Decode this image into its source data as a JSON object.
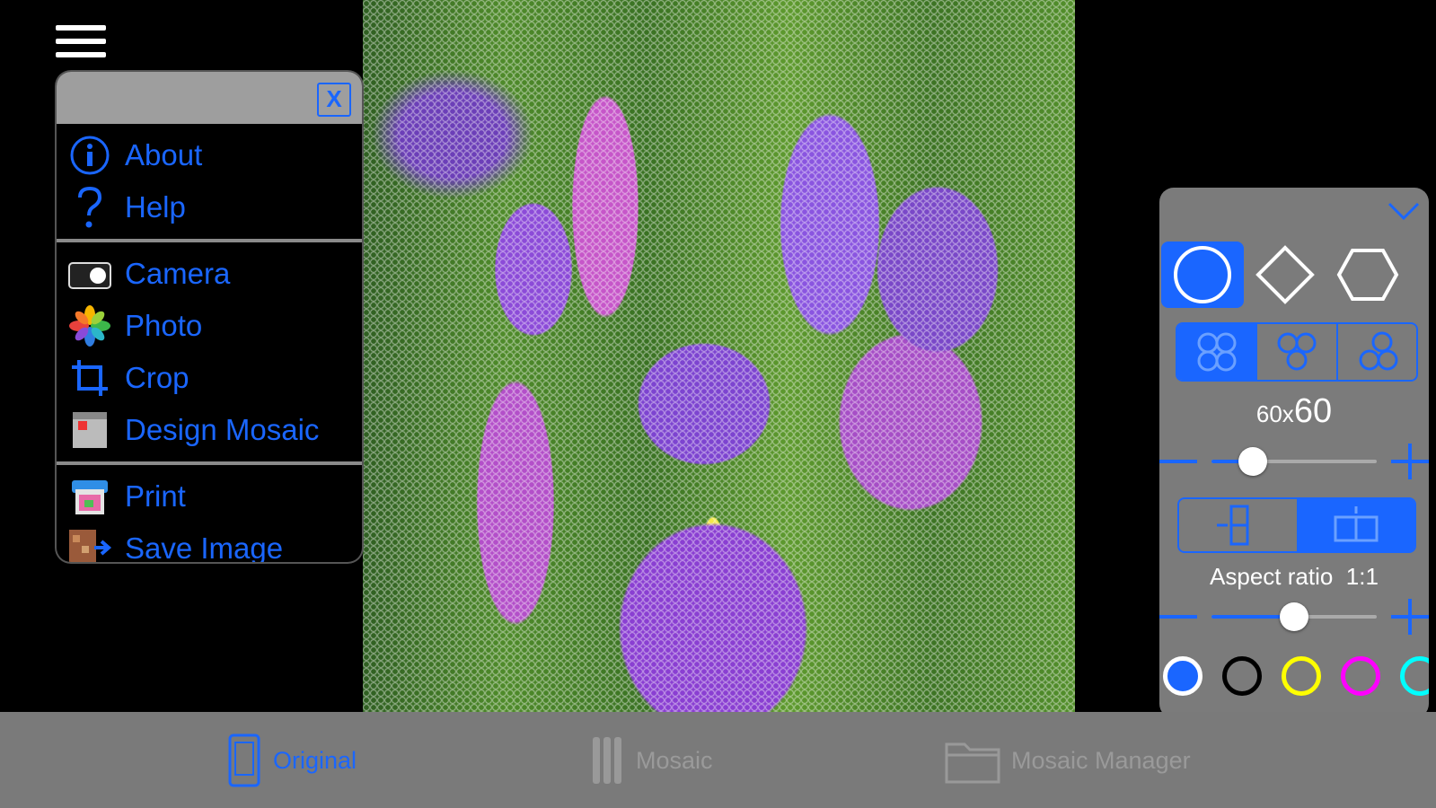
{
  "menu": {
    "close_label": "X",
    "groups": [
      [
        {
          "label": "About",
          "icon": "info-icon"
        },
        {
          "label": "Help",
          "icon": "question-icon"
        }
      ],
      [
        {
          "label": "Camera",
          "icon": "camera-icon"
        },
        {
          "label": "Photo",
          "icon": "photos-icon"
        },
        {
          "label": "Crop",
          "icon": "crop-icon"
        },
        {
          "label": "Design Mosaic",
          "icon": "design-mosaic-icon"
        }
      ],
      [
        {
          "label": "Print",
          "icon": "printer-icon"
        },
        {
          "label": "Save Image",
          "icon": "save-image-icon"
        }
      ]
    ]
  },
  "panel": {
    "shapes": [
      "circle",
      "diamond",
      "hexagon"
    ],
    "selected_shape": "circle",
    "grid_size": {
      "cols": "60x",
      "rows": "60"
    },
    "grid_slider_value": 0.25,
    "aspect_ratio_label": "Aspect ratio",
    "aspect_ratio_value": "1:1",
    "aspect_slider_value": 0.5,
    "colors": [
      "#1a66ff",
      "#000000",
      "#ffff00",
      "#ff00ff",
      "#00ffff"
    ],
    "accent": "#1a66ff"
  },
  "tabs": [
    {
      "label": "Original",
      "icon": "original-icon",
      "active": true,
      "color": "#1a66ff"
    },
    {
      "label": "Mosaic",
      "icon": "mosaic-icon",
      "active": false,
      "color": "#9a9a9a"
    },
    {
      "label": "Mosaic Manager",
      "icon": "folder-icon",
      "active": false,
      "color": "#9a9a9a"
    }
  ]
}
